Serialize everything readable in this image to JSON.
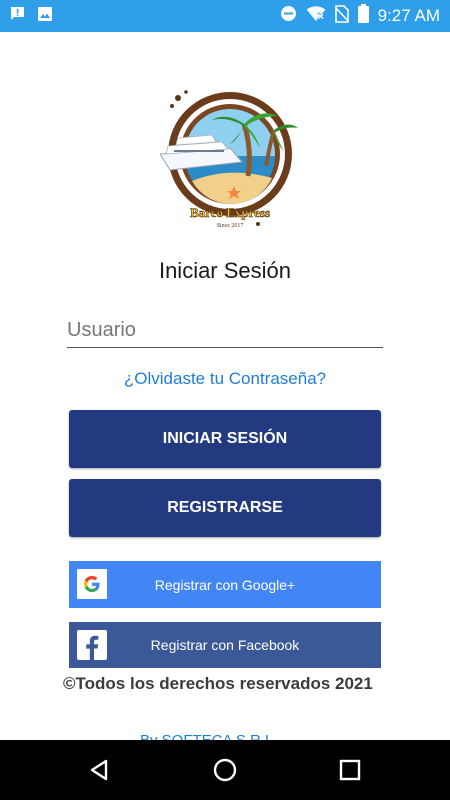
{
  "status_bar": {
    "time": "9:27 AM",
    "icons_left": [
      "notification-icon",
      "image-icon"
    ],
    "icons_right": [
      "do-not-disturb-icon",
      "wifi-off-icon",
      "no-sim-icon",
      "battery-icon"
    ]
  },
  "logo": {
    "brand_text": "Barco Express",
    "since_text": "Since 2017"
  },
  "login": {
    "title": "Iniciar Sesión",
    "username_placeholder": "Usuario",
    "username_value": "",
    "forgot_password": "¿Olvidaste tu Contraseña?",
    "login_button": "INICIAR SESIÓN",
    "register_button": "REGISTRARSE",
    "google_button": "Registrar con Google+",
    "facebook_button": "Registrar con Facebook"
  },
  "footer": {
    "copyright": "©Todos los derechos reservados 2021",
    "credit": "By SOFTECA S.R.L."
  },
  "nav_bar": {
    "buttons": [
      "back-icon",
      "home-icon",
      "recents-icon"
    ]
  },
  "colors": {
    "status_bar": "#2f9fea",
    "primary_button": "#233a80",
    "google": "#4285f4",
    "facebook": "#3b5998",
    "link": "#1e7dd7"
  }
}
